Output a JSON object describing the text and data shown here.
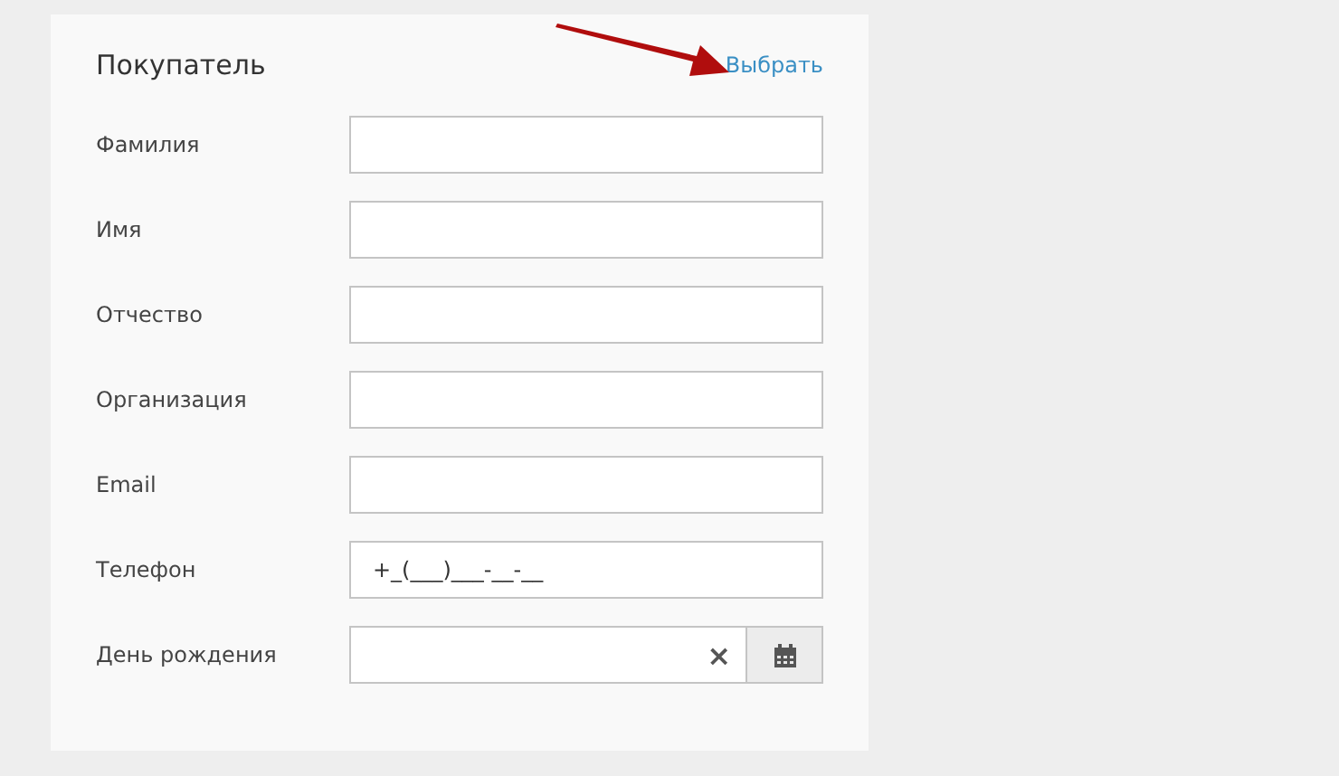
{
  "panel": {
    "title": "Покупатель",
    "select_link": "Выбрать"
  },
  "fields": [
    {
      "label": "Фамилия",
      "kind": "text"
    },
    {
      "label": "Имя",
      "kind": "text"
    },
    {
      "label": "Отчество",
      "kind": "text"
    },
    {
      "label": "Организация",
      "kind": "text"
    },
    {
      "label": "Email",
      "kind": "text"
    },
    {
      "label": "Телефон",
      "kind": "text",
      "value": "+_(___)___-__-__"
    },
    {
      "label": "День рождения",
      "kind": "date",
      "clear": "×"
    }
  ]
}
